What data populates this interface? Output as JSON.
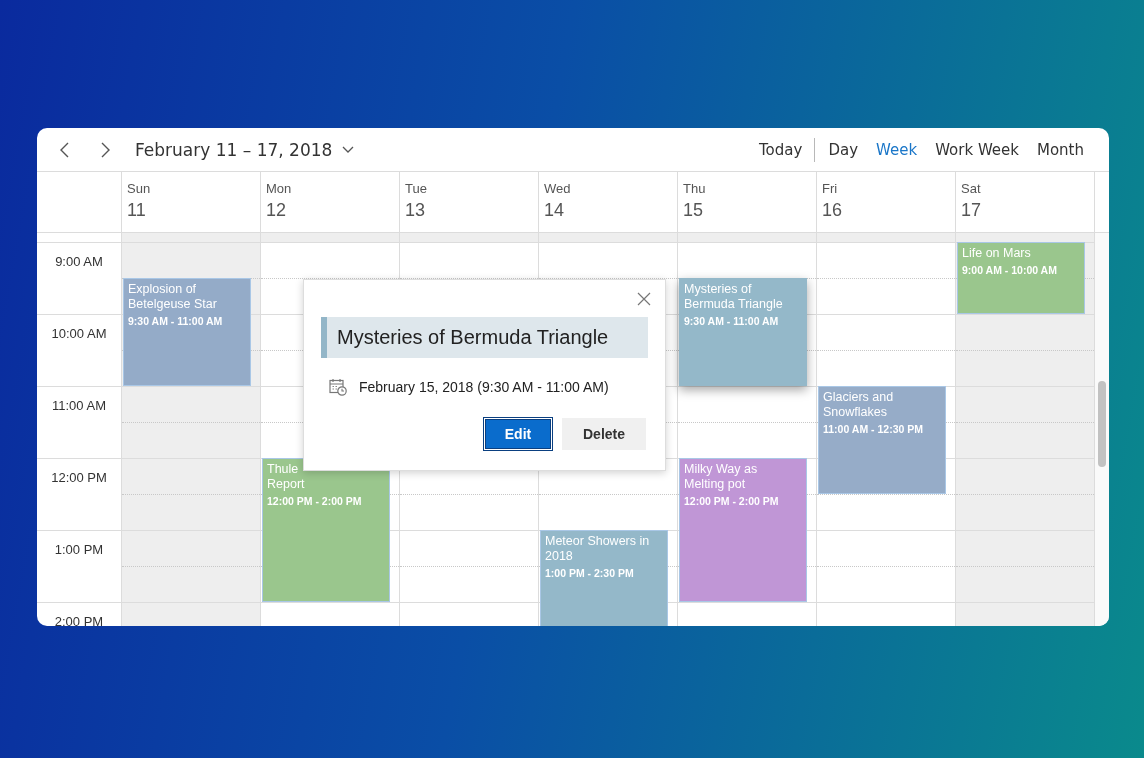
{
  "toolbar": {
    "date_range": "February 11 – 17, 2018",
    "today": "Today",
    "views": [
      {
        "label": "Day",
        "selected": false
      },
      {
        "label": "Week",
        "selected": true
      },
      {
        "label": "Work Week",
        "selected": false
      },
      {
        "label": "Month",
        "selected": false
      }
    ]
  },
  "time_slots": [
    "9:00 AM",
    "10:00 AM",
    "11:00 AM",
    "12:00 PM",
    "1:00 PM",
    "2:00 PM"
  ],
  "days": [
    {
      "name": "Sun",
      "date": "11",
      "workday": false,
      "events": [
        {
          "title_lines": [
            "Explosion of",
            "Betelgeuse Star"
          ],
          "time": "9:30 AM - 11:00 AM",
          "color": "#94abc8",
          "selected": false
        }
      ]
    },
    {
      "name": "Mon",
      "date": "12",
      "workday": true,
      "events": [
        {
          "title_lines": [
            "Thule",
            "Report"
          ],
          "time": "12:00 PM - 2:00 PM",
          "color": "#9ac68d",
          "selected": false
        }
      ]
    },
    {
      "name": "Tue",
      "date": "13",
      "workday": true
    },
    {
      "name": "Wed",
      "date": "14",
      "workday": true,
      "events": [
        {
          "title_lines": [
            "Meteor Showers in",
            "2018"
          ],
          "time": "1:00 PM - 2:30 PM",
          "color": "#94b8c9",
          "selected": false
        }
      ]
    },
    {
      "name": "Thu",
      "date": "15",
      "workday": true,
      "events": [
        {
          "title_lines": [
            "Mysteries of",
            "Bermuda Triangle"
          ],
          "time": "9:30 AM - 11:00 AM",
          "color": "#94b8c9",
          "selected": true
        },
        {
          "title_lines": [
            "Milky Way as",
            "Melting pot"
          ],
          "time": "12:00 PM - 2:00 PM",
          "color": "#c096d6",
          "selected": false
        }
      ]
    },
    {
      "name": "Fri",
      "date": "16",
      "workday": true,
      "events": [
        {
          "title_lines": [
            "Glaciers and",
            "Snowflakes"
          ],
          "time": "11:00 AM - 12:30 PM",
          "color": "#96acc8",
          "selected": false
        }
      ]
    },
    {
      "name": "Sat",
      "date": "17",
      "workday": false,
      "events": [
        {
          "title_lines": [
            "Life on Mars"
          ],
          "time": "9:00 AM - 10:00 AM",
          "color": "#9ac68d",
          "selected": false
        }
      ]
    }
  ],
  "popup": {
    "title": "Mysteries of Bermuda Triangle",
    "details": "February 15, 2018 (9:30 AM - 11:00 AM)",
    "buttons": [
      {
        "label": "Edit",
        "kind": "primary"
      },
      {
        "label": "Delete",
        "kind": "secondary"
      }
    ]
  }
}
